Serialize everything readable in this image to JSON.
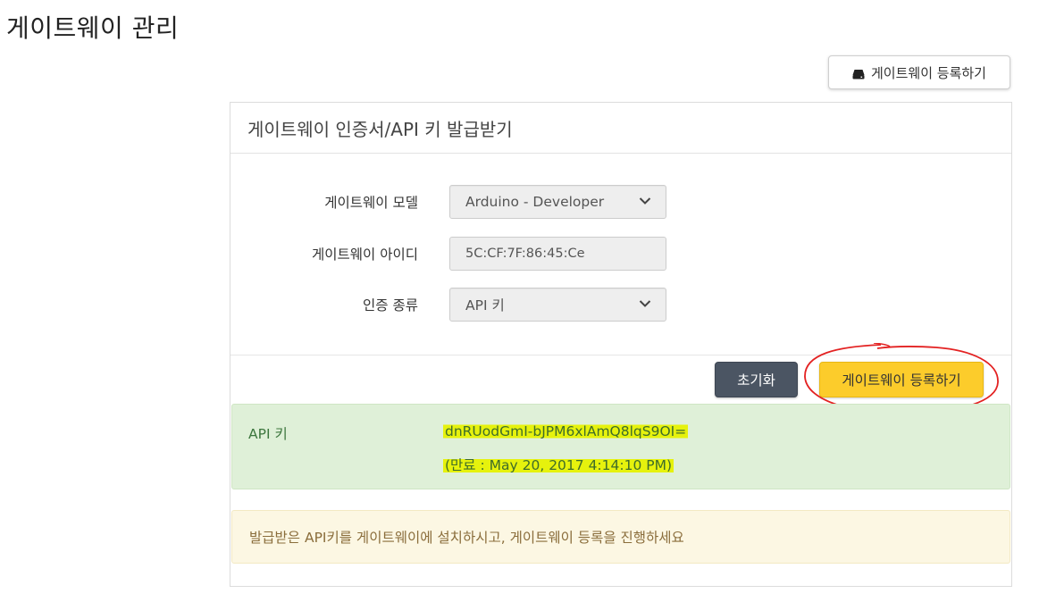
{
  "page": {
    "title": "게이트웨이 관리"
  },
  "top_action": {
    "icon": "hdd-icon",
    "label": "게이트웨이 등록하기"
  },
  "panel": {
    "heading": "게이트웨이 인증서/API 키 발급받기",
    "form": {
      "model_label": "게이트웨이 모델",
      "model_value": "Arduino - Developer",
      "id_label": "게이트웨이 아이디",
      "id_value": "5C:CF:7F:86:45:Ce",
      "auth_label": "인증 종류",
      "auth_value": "API 키"
    },
    "buttons": {
      "reset_label": "초기화",
      "register_label": "게이트웨이 등록하기"
    },
    "result": {
      "label": "API 키",
      "api_key": "dnRUodGmI-bJPM6xlAmQ8lqS9OI=",
      "expiry": "(만료 : May 20, 2017 4:14:10 PM)"
    },
    "notice": "발급받은 API키를 게이트웨이에 설치하시고, 게이트웨이 등록을 진행하세요"
  },
  "colors": {
    "reset_button": "#4b5563",
    "register_button": "#fccc2b",
    "success_bg": "#dff0d8",
    "warning_bg": "#fcf7e3",
    "highlight": "#e6f20d",
    "annotation_circle": "#e32222"
  }
}
